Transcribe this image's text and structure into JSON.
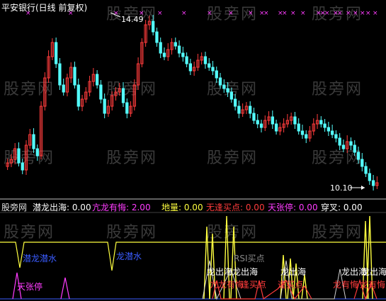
{
  "window": {
    "title": "平安银行(日线 前复权)",
    "watermark": "股旁网",
    "colors": {
      "up": "#ff3c3c",
      "down": "#54ffff",
      "frame": "#c0c0c0",
      "marker": "#ff3cff"
    }
  },
  "main_chart": {
    "high_label": "14.49",
    "low_label": "10.10"
  },
  "legend": {
    "name": "股旁网",
    "item1": "潜龙出海: 0.00",
    "item2": "亢龙有悔: 2.00",
    "item3": "地量: 0.00",
    "item4": "无逢买点: 0.00",
    "item5": "天张停: 0.00",
    "item6": "穿叉: 0.00",
    "colors": {
      "item1": "#ffffff",
      "item2": "#ff3cff",
      "item3": "#ffff40",
      "item4": "#ff3c3c",
      "item5": "#ff3cff",
      "item6": "#ffffff"
    }
  },
  "indicator": {
    "labels": {
      "qianshui1": "潜龙潜水",
      "qianshui2": "龙潜水",
      "tianzhangting": "天张停",
      "rsi": "RSI买点",
      "chuhai1": "龙出海",
      "chuhai2": "龙出海",
      "chuhai3": "龙出海",
      "chuhai4": "龙出海",
      "chuhai5": "龙出海",
      "mai1": "亢龙有悔",
      "mai2": "逢买点",
      "mai3": "逢买点",
      "mai4": "龙有悔",
      "mai5": "龙有悔"
    }
  }
}
